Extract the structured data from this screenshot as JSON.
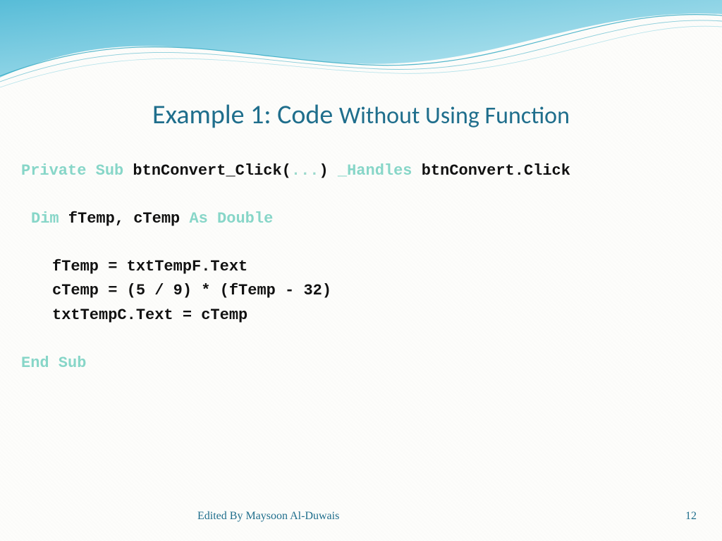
{
  "title": {
    "part1": "Example 1: Code ",
    "part2": "Without Using Function"
  },
  "code": {
    "kw_private": "Private",
    "kw_sub": "Sub",
    "sig_name": " btnConvert_Click(",
    "sig_dots": "...",
    "sig_close": ") ",
    "underscore": "_",
    "kw_handles": "Handles",
    "handles_target": " btnConvert.Click",
    "kw_dim": "Dim",
    "dim_vars": " fTemp, cTemp ",
    "kw_as": "As",
    "kw_double": " Double",
    "line1": "fTemp = txtTempF.Text",
    "line2": "cTemp = (5 / 9) * (fTemp - 32)",
    "line3": "txtTempC.Text = cTemp",
    "kw_end_sub": "End Sub"
  },
  "footer": {
    "credit": "Edited By Maysoon Al-Duwais",
    "page": "12"
  }
}
